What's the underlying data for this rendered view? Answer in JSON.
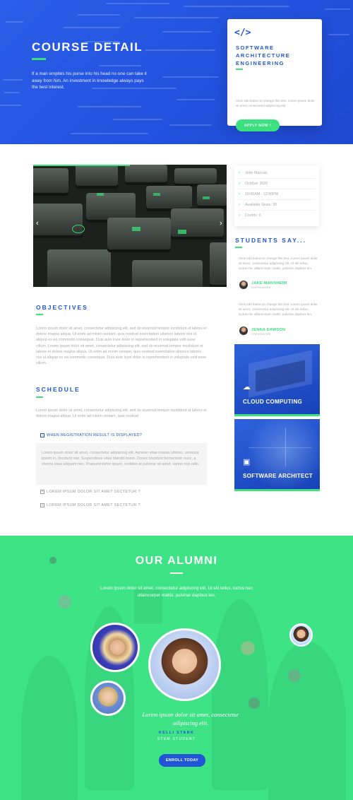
{
  "hero": {
    "title": "COURSE DETAIL",
    "text": "If a man empties his purse into his head no one can take it away from him. An investment in knowledge always pays the best interest."
  },
  "course_card": {
    "icon": "code-icon",
    "title": "SOFTWARE ARCHITECTURE ENGINEERING",
    "text": "Click edit button to change this text. Lorem ipsum dolor sit amet consectetur adipiscing elit.",
    "button": "APPLY NOW !"
  },
  "info": {
    "items": [
      "John Marcois",
      "October 2020",
      "10:00AM - 12:00PM",
      "Available Seats: 30",
      "Credits: 6"
    ]
  },
  "students": {
    "title": "STUDENTS SAY...",
    "testimonials": [
      {
        "text": "Click edit button to change this text. Lorem ipsum dolor sit amet, consectetur adipiscing elit. Ut elit tellus, luctus nec ullamcorper mattis, pulvinar dapibus leo.",
        "name": "JAKE MANNHEIM",
        "role": "SOPHOMORE"
      },
      {
        "text": "Click edit button to change this text. Lorem ipsum dolor sit amet, consectetur adipiscing elit. Ut elit tellus, luctus nec ullamcorper mattis, pulvinar dapibus leo.",
        "name": "JENNA DAWSON",
        "role": "SOPHOMORE"
      }
    ]
  },
  "courses": [
    {
      "title": "CLOUD COMPUTING",
      "icon": "cloud-icon"
    },
    {
      "title": "SOFTWARE ARCHITECT",
      "icon": "monitor-icon"
    }
  ],
  "objectives": {
    "title": "OBJECTIVES",
    "text": "Lorem ipsum dolor sit amet, consectetur adipiscing elit, sed do eiusmod tempor incididunt ut labore et dolore magna aliqua. Ut enim ad minim veniam, quis nostrud exercitation ullamco laboris nisi ut aliquip ex ea commodo consequat. Duis aute irure dolor in reprehenderit in voluptate velit esse cillum. Lorem ipsum dolor sit amet, consectetur adipiscing elit, sed do eiusmod tempor incididunt ut labore et dolore magna aliqua. Ut enim ad minim veniam, quis nostrud exercitation ullamco laboris nisi ut aliquip ex ea commodo consequat. Duis aute irure dolor in reprehenderit in voluptate velit esse cillum."
  },
  "schedule": {
    "title": "SCHEDULE",
    "text": "Lorem ipsum dolor sit amet, consectetur adipiscing elit, sed do eiusmod tempor incididunt ut labore et dolore magna aliqua. Ut enim ad minim veniam, quis nostrud",
    "accordion": [
      {
        "label": "WHEN REGISTRATION RESULT IS DISPLAYED?",
        "open": true,
        "content": "Lorem ipsum dolor sit amet, consectetur adipiscing elit. Aenean vitae massa ultrices, vehicula ipsum in, tincidunt nisi. Suspendisse vitae blandit lorem. Donec tincidunt fermentum nunc, a viverra risus aliquam nec. Praesent tortor ipsum, sodales at pulvinar sit amet, varius non odio."
      },
      {
        "label": "LOREM IPSUM DOLOR SIT AMET SECTETUR ?",
        "open": false
      },
      {
        "label": "LOREM IPSUM DOLOR SIT AMET SECTETUR ?",
        "open": false
      }
    ]
  },
  "alumni": {
    "title": "OUR ALUMNI",
    "text": "Lorem ipsum dolor sit amet, consectetur adipiscing elit. Ut elit tellus, luctus nec ullamcorper mattis, pulvinar dapibus leo.",
    "quote": "Lorem ipsum dolor sit amet, consectetur adipiscing elit.",
    "name": "KELLI STARK",
    "role": "STEM STUDENT",
    "button": "ENROLL TODAY"
  },
  "colors": {
    "blue": "#1f55d6",
    "green": "#3be07f",
    "alumni_bg": "#3ee385"
  }
}
